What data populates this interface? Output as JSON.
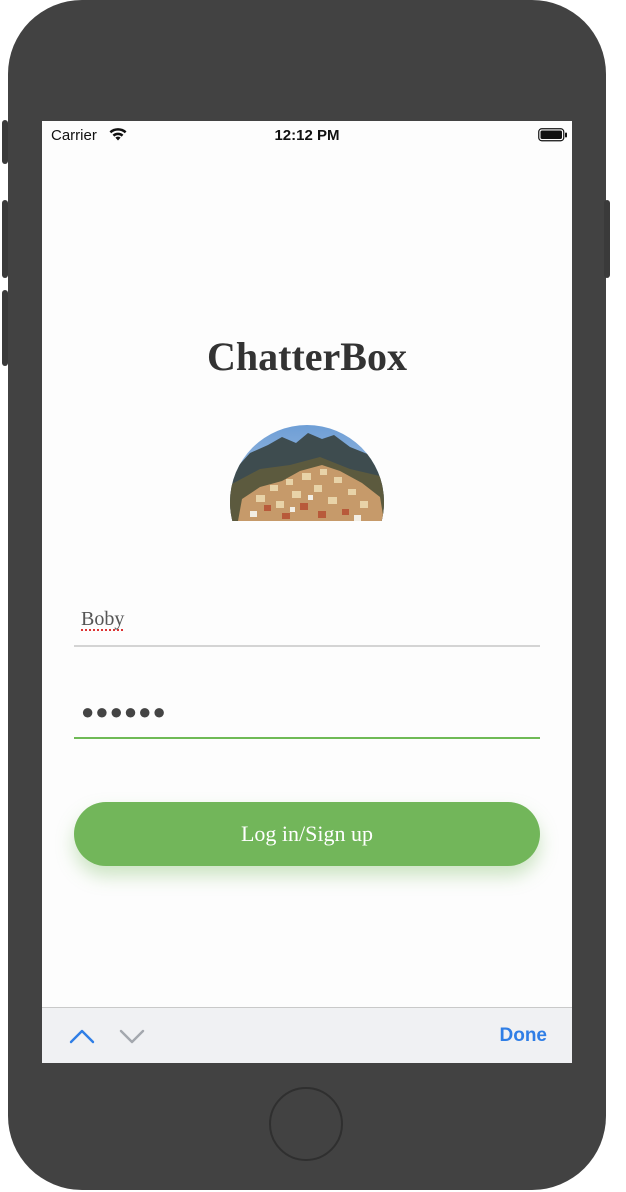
{
  "status_bar": {
    "carrier": "Carrier",
    "time": "12:12 PM",
    "wifi_icon": "wifi-icon",
    "battery_icon": "battery-full-icon"
  },
  "app": {
    "title": "ChatterBox",
    "hero_image": "hillside-village-photo"
  },
  "form": {
    "username_value": "Boby",
    "password_value": "●●●●●●",
    "login_label": "Log in/Sign up"
  },
  "keyboard_toolbar": {
    "previous_icon": "chevron-up-icon",
    "next_icon": "chevron-down-icon",
    "done_label": "Done"
  },
  "colors": {
    "accent_green": "#72b65a",
    "done_blue": "#2f7ee6",
    "device_body": "#424242"
  }
}
